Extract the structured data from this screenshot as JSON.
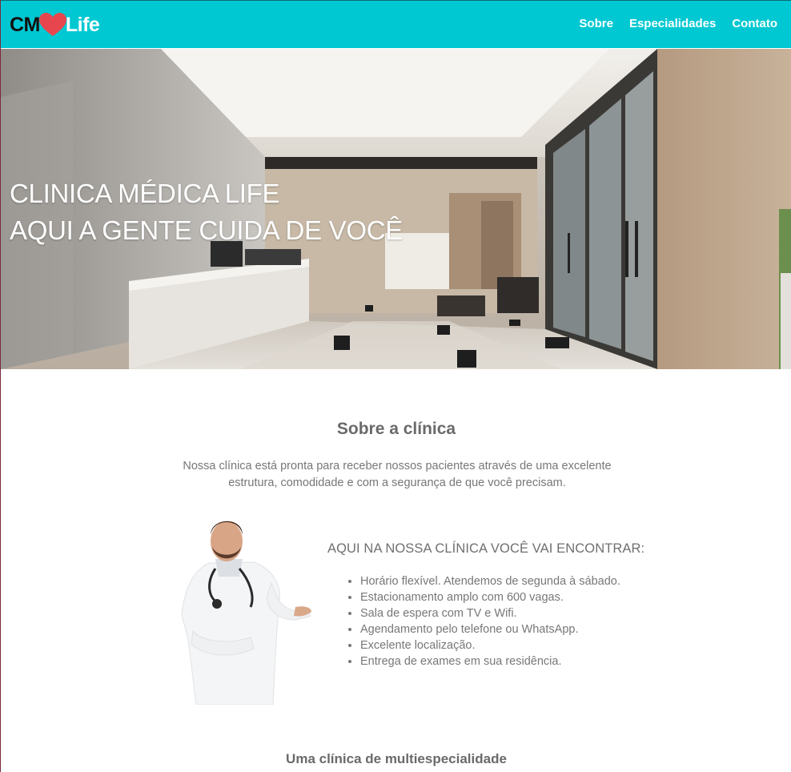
{
  "header": {
    "logo": {
      "left": "CM",
      "right": "Life",
      "icon": "heart-icon"
    },
    "nav": [
      "Sobre",
      "Especialidades",
      "Contato"
    ]
  },
  "hero": {
    "line1": "CLINICA MÉDICA LIFE",
    "line2": "AQUI A GENTE CUIDA DE VOCÊ"
  },
  "about": {
    "title": "Sobre a clínica",
    "description": "Nossa clínica está pronta para receber nossos pacientes através de uma excelente estrutura, comodidade e com a segurança de que você precisam.",
    "find_title": "AQUI NA NOSSA CLÍNICA VOCÊ VAI ENCONTRAR:",
    "features": [
      "Horário flexível. Atendemos de segunda à sábado.",
      "Estacionamento amplo com 600 vagas.",
      "Sala de espera com TV e Wifi.",
      "Agendamento pelo telefone ou WhatsApp.",
      "Excelente localização.",
      "Entrega de exames em sua residência."
    ]
  },
  "specialties": {
    "title": "Uma clínica de multiespecialidade"
  },
  "colors": {
    "header_bg": "#00c8d2",
    "heart": "#e8464e",
    "text_gray": "#6b6b6b"
  }
}
